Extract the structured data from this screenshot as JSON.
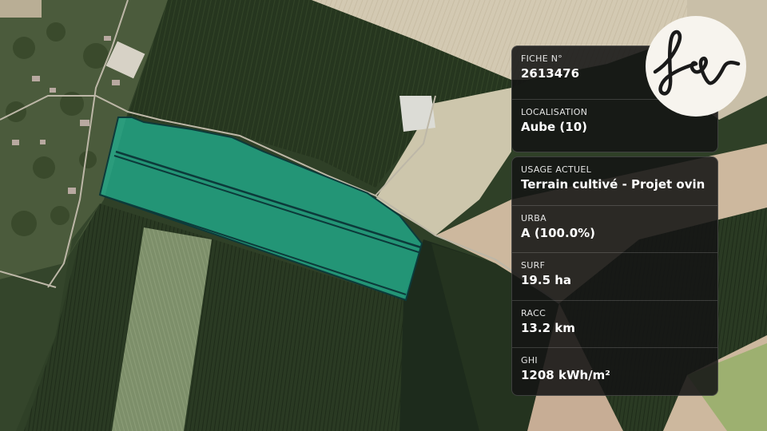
{
  "map": {
    "parcel_fill": "#1fb596",
    "parcel_outline": "#0c3a3a",
    "field_dark": "#27371f",
    "field_light": "#d9ceb9"
  },
  "card_ref": {
    "fiche_label": "FICHE N°",
    "fiche_value": "2613476",
    "loc_label": "LOCALISATION",
    "loc_value": "Aube (10)"
  },
  "card_details": {
    "usage_label": "USAGE ACTUEL",
    "usage_value": "Terrain cultivé - Projet ovin",
    "urba_label": "URBA",
    "urba_value": "A (100.0%)",
    "surf_label": "SURF",
    "surf_value": "19.5 ha",
    "racc_label": "RACC",
    "racc_value": "13.2 km",
    "ghi_label": "GHI",
    "ghi_value": "1208 kWh/m²"
  },
  "logo": {
    "icon": "fs-monogram-logo",
    "text": "fs"
  }
}
